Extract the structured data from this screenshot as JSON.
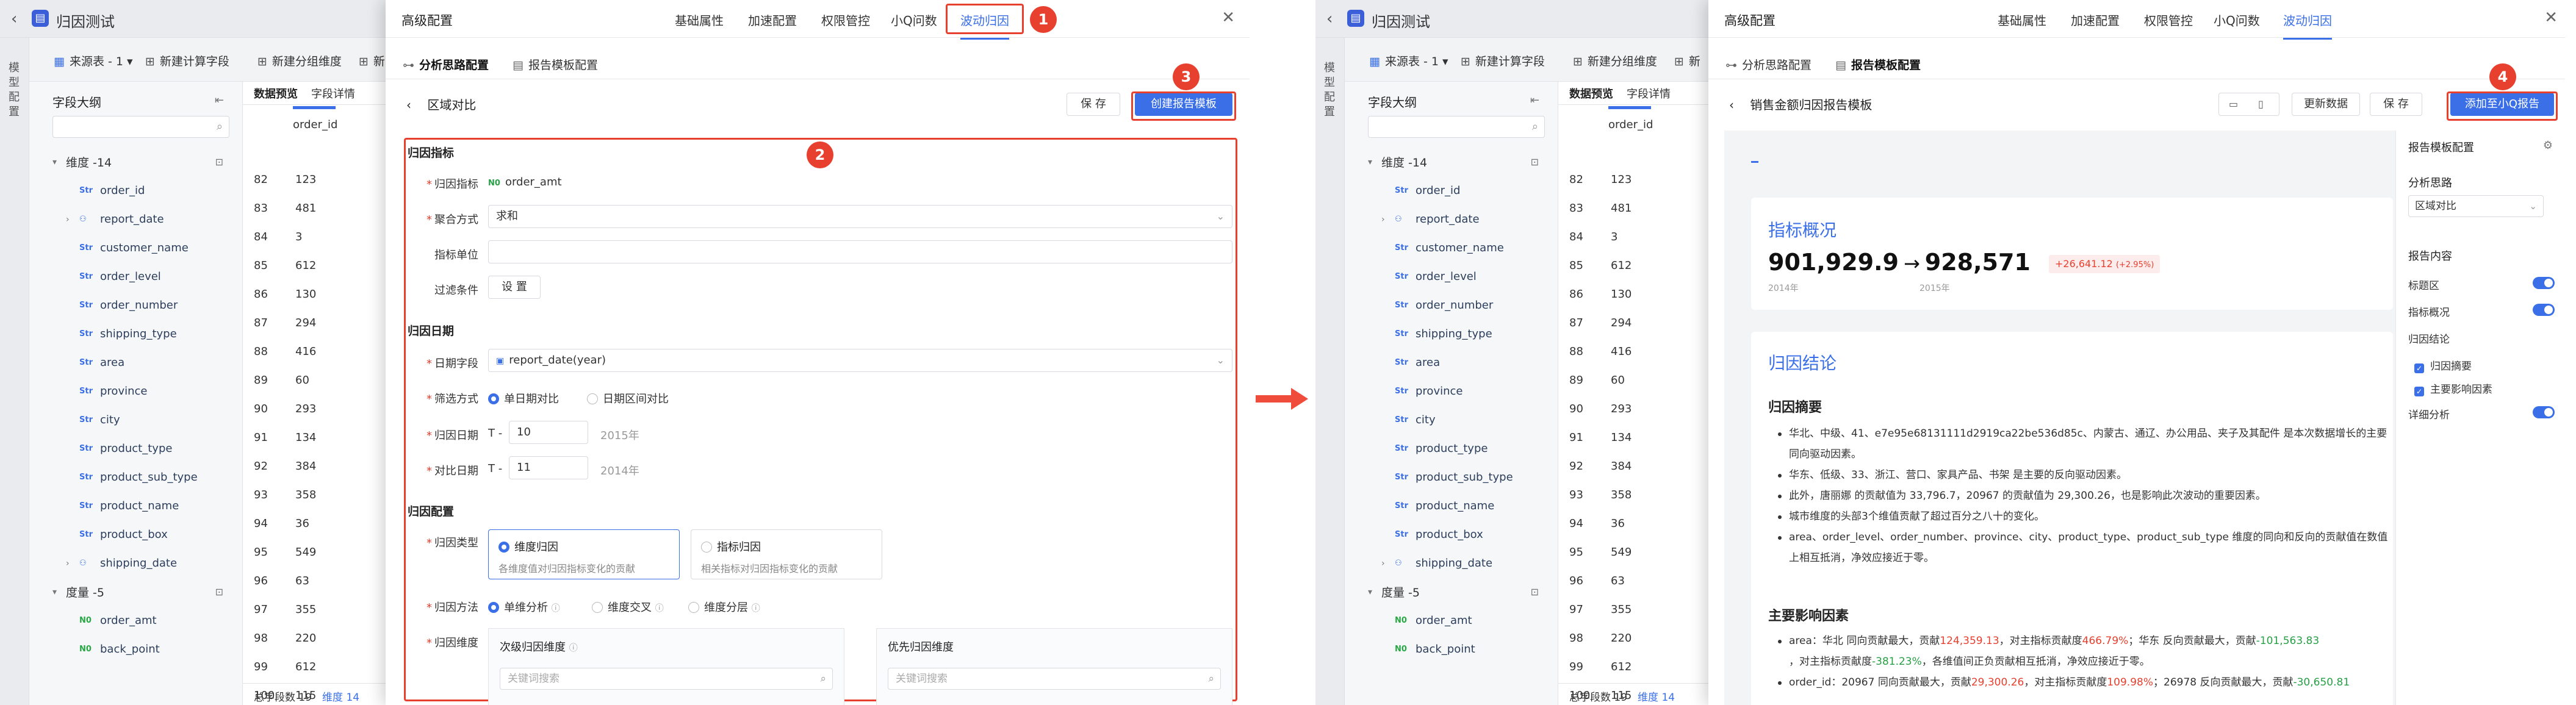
{
  "left": {
    "app_title": "归因测试",
    "vnav": "模型配置",
    "toolbar": {
      "source": "来源表 - 1",
      "calc_field": "新建计算字段",
      "group_dim": "新建分组维度",
      "more": "新"
    },
    "fields": {
      "title": "字段大纲",
      "dim_group": "维度 -14",
      "dims": [
        "order_id",
        "report_date",
        "customer_name",
        "order_level",
        "order_number",
        "shipping_type",
        "area",
        "province",
        "city",
        "product_type",
        "product_sub_type",
        "product_name",
        "product_box",
        "shipping_date"
      ],
      "measure_group": "度量 -5",
      "measures": [
        "order_amt",
        "back_point"
      ]
    },
    "preview": {
      "tab1": "数据预览",
      "tab2": "字段详情",
      "col": "order_id",
      "rows": [
        [
          "82",
          "123"
        ],
        [
          "83",
          "481"
        ],
        [
          "84",
          "3"
        ],
        [
          "85",
          "612"
        ],
        [
          "86",
          "130"
        ],
        [
          "87",
          "294"
        ],
        [
          "88",
          "416"
        ],
        [
          "89",
          "60"
        ],
        [
          "90",
          "293"
        ],
        [
          "91",
          "134"
        ],
        [
          "92",
          "384"
        ],
        [
          "93",
          "358"
        ],
        [
          "94",
          "36"
        ],
        [
          "95",
          "549"
        ],
        [
          "96",
          "63"
        ],
        [
          "97",
          "355"
        ],
        [
          "98",
          "220"
        ],
        [
          "99",
          "612"
        ],
        [
          "100",
          "115"
        ]
      ],
      "footer_total": "总字段数 19",
      "footer_dim": "维度 14"
    },
    "modal": {
      "title": "高级配置",
      "tabs": [
        "基础属性",
        "加速配置",
        "权限管控",
        "小Q问数",
        "波动归因"
      ],
      "active_tab": "波动归因",
      "subtabs": [
        "分析思路配置",
        "报告模板配置"
      ],
      "back": "区域对比",
      "save": "保 存",
      "create": "创建报告模板",
      "sec_metric": "归因指标",
      "metric_label": "归因指标",
      "metric_value": "order_amt",
      "agg_label": "聚合方式",
      "agg_value": "求和",
      "unit_label": "指标单位",
      "filter_label": "过滤条件",
      "filter_btn": "设 置",
      "sec_date": "归因日期",
      "date_field_label": "日期字段",
      "date_field_value": "report_date(year)",
      "filter_mode_label": "筛选方式",
      "filter_mode_opts": [
        "单日期对比",
        "日期区间对比"
      ],
      "attr_date_label": "归因日期",
      "attr_t": "T -",
      "attr_val": "10",
      "attr_year": "2015年",
      "cmp_date_label": "对比日期",
      "cmp_t": "T -",
      "cmp_val": "11",
      "cmp_year": "2014年",
      "sec_conf": "归因配置",
      "type_label": "归因类型",
      "type_a_title": "维度归因",
      "type_a_desc": "各维度值对归因指标变化的贡献",
      "type_b_title": "指标归因",
      "type_b_desc": "相关指标对归因指标变化的贡献",
      "method_label": "归因方法",
      "method_opts": [
        "单维分析",
        "维度交叉",
        "维度分层"
      ],
      "dim_label": "归因维度",
      "col1": "次级归因维度",
      "col2": "优先归因维度",
      "search_ph": "关键词搜索"
    },
    "badges": [
      "1",
      "2",
      "3"
    ]
  },
  "right": {
    "app_title": "归因测试",
    "modal": {
      "title": "高级配置",
      "tabs": [
        "基础属性",
        "加速配置",
        "权限管控",
        "小Q问数",
        "波动归因"
      ],
      "subtabs": [
        "分析思路配置",
        "报告模板配置"
      ],
      "back": "销售金额归因报告模板",
      "refresh": "更新数据",
      "save": "保 存",
      "add": "添加至小Q报告",
      "badge": "4"
    },
    "report": {
      "overview_title": "指标概况",
      "value_old": "901,929.9",
      "value_new": "928,571",
      "year_old": "2014年",
      "year_new": "2015年",
      "delta": "+26,641.12",
      "delta_pct": "(+2.95%)",
      "conclusion_title": "归因结论",
      "summary_title": "归因摘要",
      "summary": [
        "华北、中级、41、e7e95e68131111d2919ca22be536d85c、内蒙古、通辽、办公用品、夹子及其配件 是本次数据增长的主要同向驱动因素。",
        "华东、低级、33、浙江、营口、家具产品、书架 是主要的反向驱动因素。",
        "此外，唐丽娜 的贡献值为 33,796.7，20967 的贡献值为 29,300.26，也是影响此次波动的重要因素。",
        "城市维度的头部3个维值贡献了超过百分之八十的变化。",
        "area、order_level、order_number、province、city、product_type、product_sub_type 维度的同向和反向的贡献值在数值上相互抵消，净效应接近于零。"
      ],
      "factors_title": "主要影响因素",
      "factor1_a": "area：华北 同向贡献最大，贡献",
      "factor1_v": "124,359.13",
      "factor1_b": "，对主指标贡献度",
      "factor1_p": "466.79%",
      "factor1_c": "；华东 反向贡献最大，贡献",
      "factor1_v2": "-101,563.83",
      "factor1_line2a": "，对主指标贡献度",
      "factor1_line2p": "-381.23%",
      "factor1_line2b": "，各维值间正负贡献相互抵消，净效应接近于零。",
      "factor2_a": "order_id：20967 同向贡献最大，贡献",
      "factor2_v": "29,300.26",
      "factor2_b": "，对主指标贡献度",
      "factor2_p": "109.98%",
      "factor2_c": "；26978 反向贡献最大，贡献",
      "factor2_v2": "-30,650.81"
    },
    "side": {
      "title": "报告模板配置",
      "idea_label": "分析思路",
      "idea_value": "区域对比",
      "content_label": "报告内容",
      "title_area": "标题区",
      "overview": "指标概况",
      "conclusion": "归因结论",
      "summary": "归因摘要",
      "factors": "主要影响因素",
      "detail": "详细分析"
    }
  },
  "colors": {
    "accent": "#3a6fe8",
    "highlight": "#e8402f",
    "positive": "#27a046"
  }
}
